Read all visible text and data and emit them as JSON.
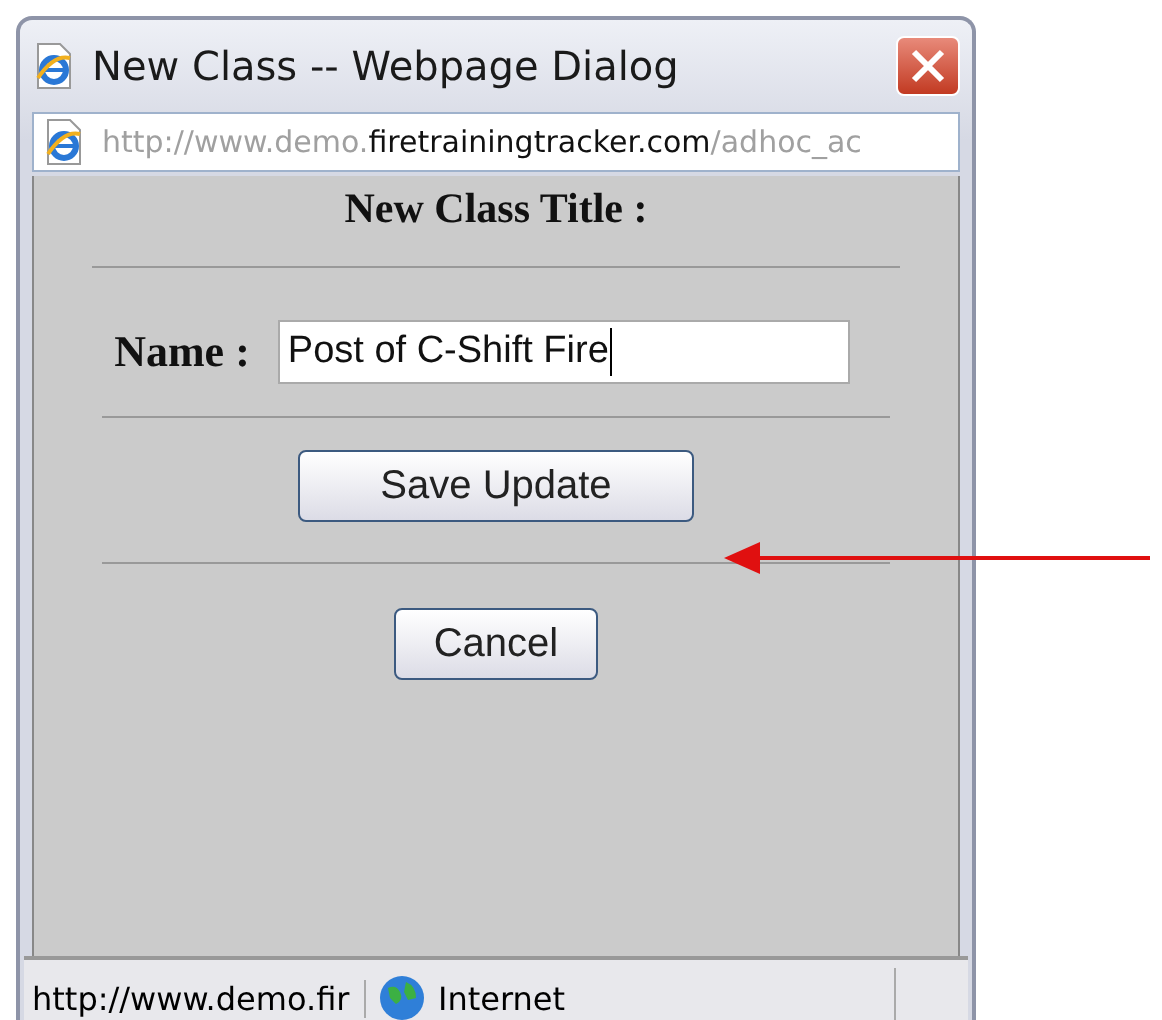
{
  "window": {
    "title": "New Class -- Webpage Dialog"
  },
  "address_bar": {
    "prefix": "http://www.demo.",
    "domain": "firetrainingtracker.com",
    "suffix": "/adhoc_ac"
  },
  "form": {
    "heading": "New Class Title :",
    "name_label": "Name :",
    "name_value": "Post of C-Shift Fire"
  },
  "buttons": [
    "Save Update",
    "Cancel"
  ],
  "status_bar": {
    "url": "http://www.demo.fir",
    "zone": "Internet"
  }
}
